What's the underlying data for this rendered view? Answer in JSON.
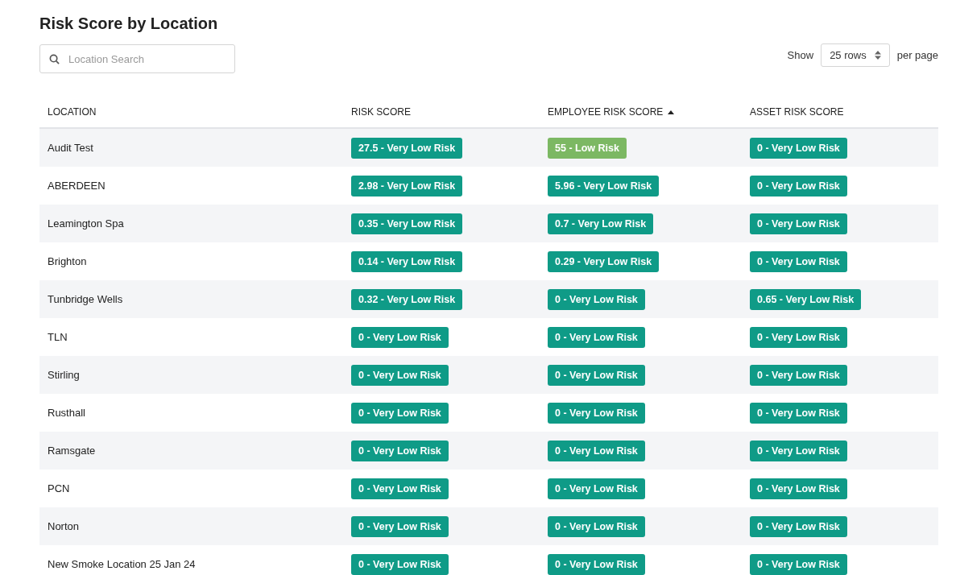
{
  "title": "Risk Score by Location",
  "search": {
    "placeholder": "Location Search"
  },
  "pagination": {
    "prefix": "Show",
    "value": "25 rows",
    "suffix": "per page"
  },
  "table": {
    "columns": [
      {
        "label": "LOCATION",
        "sorted": false
      },
      {
        "label": "RISK SCORE",
        "sorted": false
      },
      {
        "label": "EMPLOYEE RISK SCORE",
        "sorted": true
      },
      {
        "label": "ASSET RISK SCORE",
        "sorted": false
      }
    ],
    "rows": [
      {
        "location": "Audit Test",
        "scores": [
          {
            "text": "27.5 - Very Low Risk",
            "color": "#0f9b87"
          },
          {
            "text": "55 - Low Risk",
            "color": "#7cb863"
          },
          {
            "text": "0 - Very Low Risk",
            "color": "#0f9b87"
          }
        ]
      },
      {
        "location": "ABERDEEN",
        "scores": [
          {
            "text": "2.98 - Very Low Risk",
            "color": "#0f9b87"
          },
          {
            "text": "5.96 - Very Low Risk",
            "color": "#0f9b87"
          },
          {
            "text": "0 - Very Low Risk",
            "color": "#0f9b87"
          }
        ]
      },
      {
        "location": "Leamington Spa",
        "scores": [
          {
            "text": "0.35 - Very Low Risk",
            "color": "#0f9b87"
          },
          {
            "text": "0.7 - Very Low Risk",
            "color": "#0f9b87"
          },
          {
            "text": "0 - Very Low Risk",
            "color": "#0f9b87"
          }
        ]
      },
      {
        "location": "Brighton",
        "scores": [
          {
            "text": "0.14 - Very Low Risk",
            "color": "#0f9b87"
          },
          {
            "text": "0.29 - Very Low Risk",
            "color": "#0f9b87"
          },
          {
            "text": "0 - Very Low Risk",
            "color": "#0f9b87"
          }
        ]
      },
      {
        "location": "Tunbridge Wells",
        "scores": [
          {
            "text": "0.32 - Very Low Risk",
            "color": "#0f9b87"
          },
          {
            "text": "0 - Very Low Risk",
            "color": "#0f9b87"
          },
          {
            "text": "0.65 - Very Low Risk",
            "color": "#0f9b87"
          }
        ]
      },
      {
        "location": "TLN",
        "scores": [
          {
            "text": "0 - Very Low Risk",
            "color": "#0f9b87"
          },
          {
            "text": "0 - Very Low Risk",
            "color": "#0f9b87"
          },
          {
            "text": "0 - Very Low Risk",
            "color": "#0f9b87"
          }
        ]
      },
      {
        "location": "Stirling",
        "scores": [
          {
            "text": "0 - Very Low Risk",
            "color": "#0f9b87"
          },
          {
            "text": "0 - Very Low Risk",
            "color": "#0f9b87"
          },
          {
            "text": "0 - Very Low Risk",
            "color": "#0f9b87"
          }
        ]
      },
      {
        "location": "Rusthall",
        "scores": [
          {
            "text": "0 - Very Low Risk",
            "color": "#0f9b87"
          },
          {
            "text": "0 - Very Low Risk",
            "color": "#0f9b87"
          },
          {
            "text": "0 - Very Low Risk",
            "color": "#0f9b87"
          }
        ]
      },
      {
        "location": "Ramsgate",
        "scores": [
          {
            "text": "0 - Very Low Risk",
            "color": "#0f9b87"
          },
          {
            "text": "0 - Very Low Risk",
            "color": "#0f9b87"
          },
          {
            "text": "0 - Very Low Risk",
            "color": "#0f9b87"
          }
        ]
      },
      {
        "location": "PCN",
        "scores": [
          {
            "text": "0 - Very Low Risk",
            "color": "#0f9b87"
          },
          {
            "text": "0 - Very Low Risk",
            "color": "#0f9b87"
          },
          {
            "text": "0 - Very Low Risk",
            "color": "#0f9b87"
          }
        ]
      },
      {
        "location": "Norton",
        "scores": [
          {
            "text": "0 - Very Low Risk",
            "color": "#0f9b87"
          },
          {
            "text": "0 - Very Low Risk",
            "color": "#0f9b87"
          },
          {
            "text": "0 - Very Low Risk",
            "color": "#0f9b87"
          }
        ]
      },
      {
        "location": "New Smoke Location 25 Jan 24",
        "scores": [
          {
            "text": "0 - Very Low Risk",
            "color": "#0f9b87"
          },
          {
            "text": "0 - Very Low Risk",
            "color": "#0f9b87"
          },
          {
            "text": "0 - Very Low Risk",
            "color": "#0f9b87"
          }
        ]
      }
    ]
  }
}
